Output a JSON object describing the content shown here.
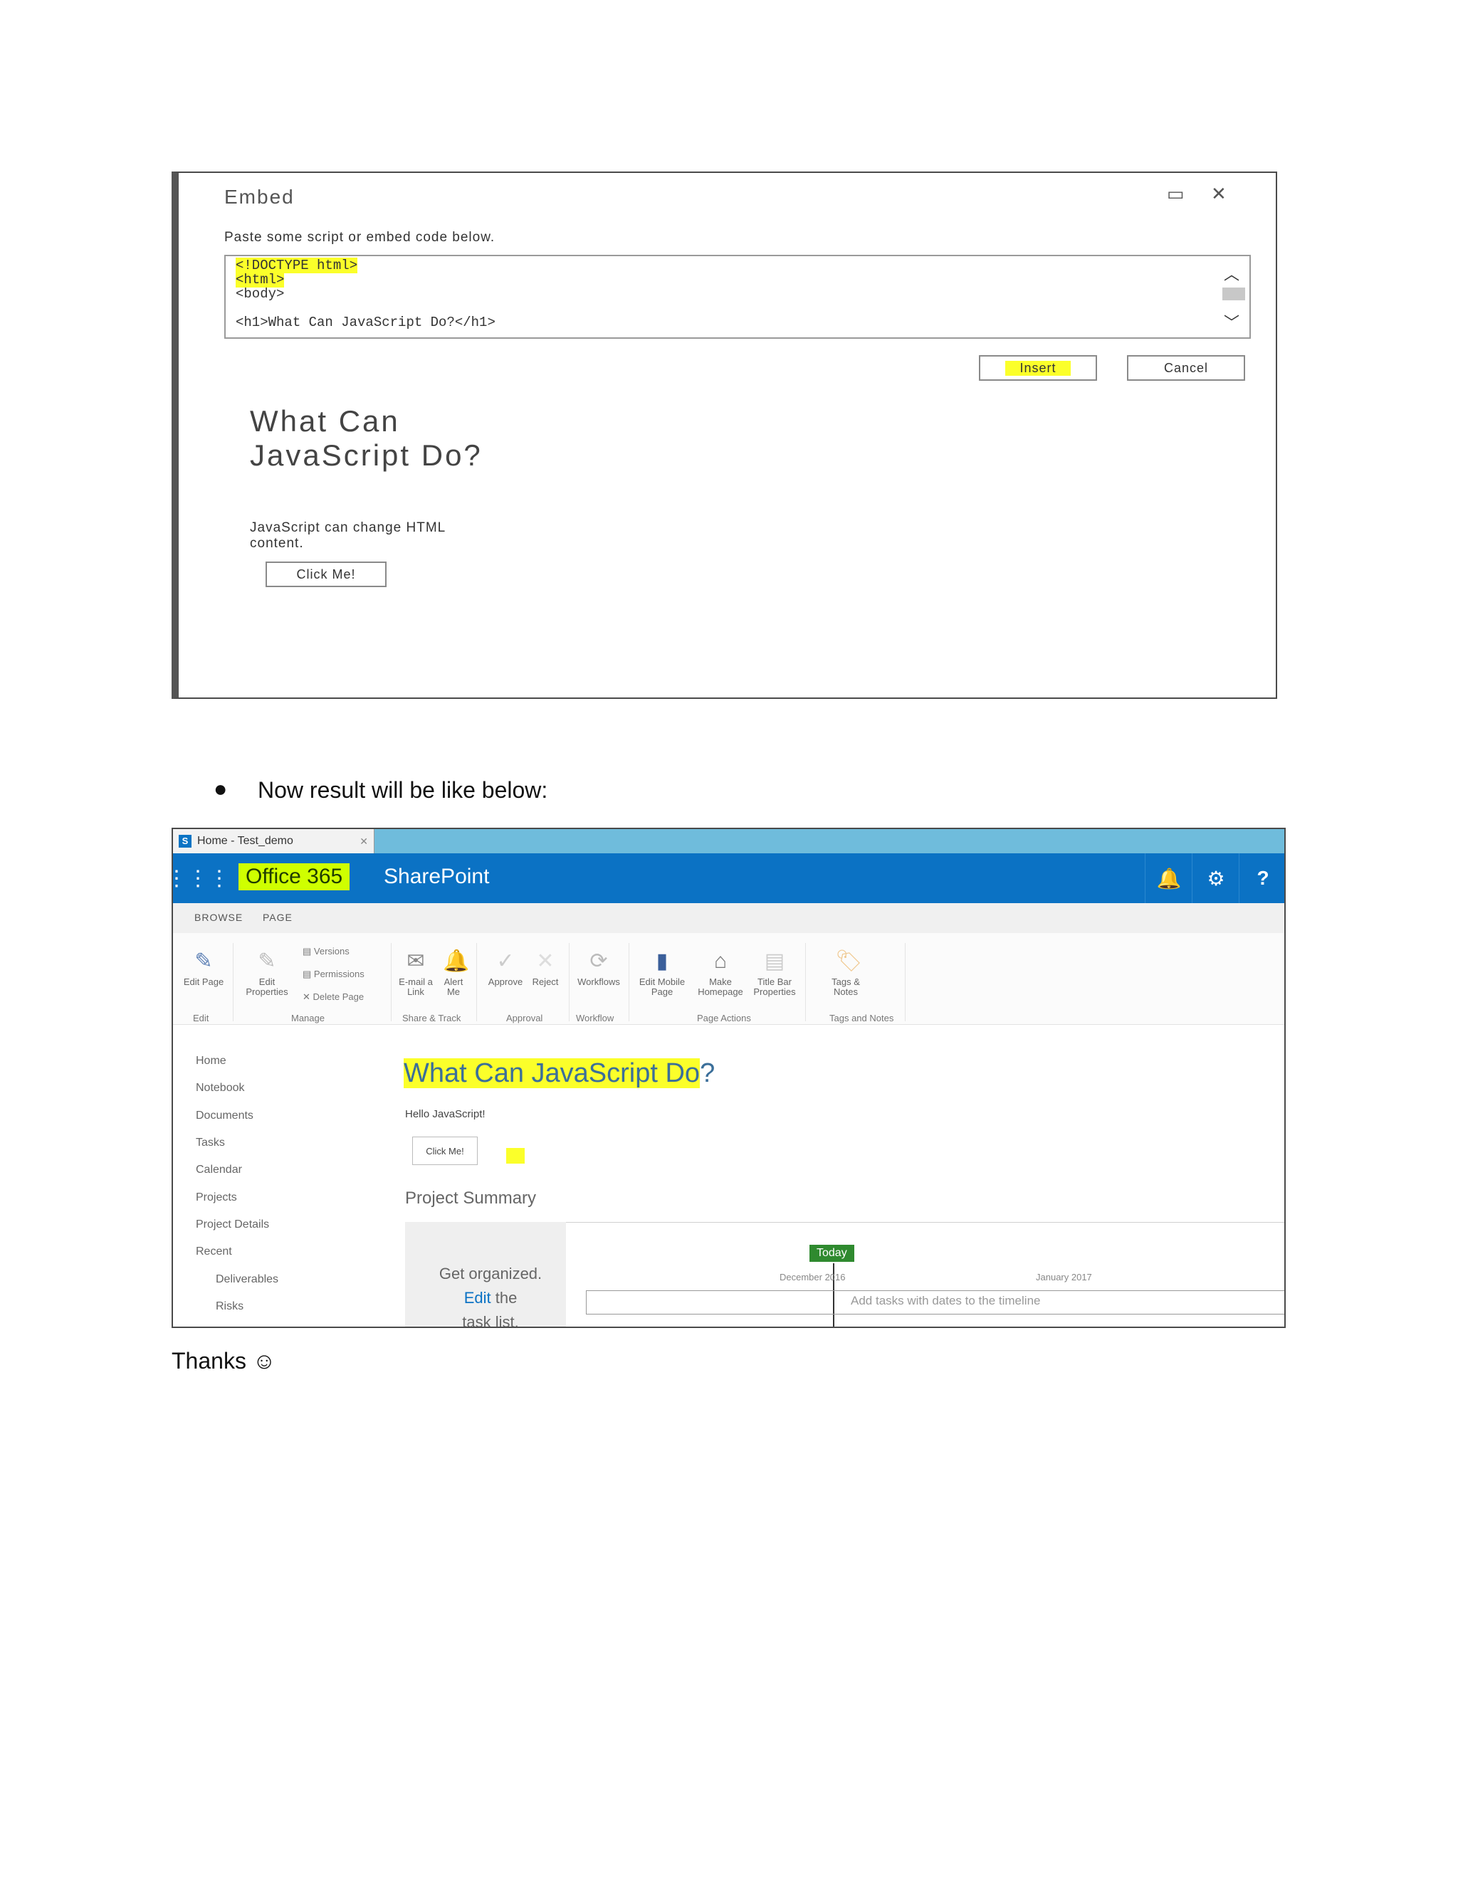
{
  "shot1": {
    "title": "Embed",
    "maximize_icon": "maximize-icon",
    "close_icon": "close-icon",
    "instruction": "Paste some script or embed code below.",
    "code_lines": [
      "<!DOCTYPE html>",
      "<html>",
      "<body>",
      "<h1>What Can JavaScript Do?</h1>"
    ],
    "insert_label": "Insert",
    "cancel_label": "Cancel",
    "preview_heading": "What Can JavaScript Do?",
    "preview_text": "JavaScript can change HTML content.",
    "preview_button": "Click Me!"
  },
  "bullet_text": "Now result will be like below:",
  "shot2": {
    "tab_title": "Home - Test_demo",
    "suite_app": "Office 365",
    "suite_site": "SharePoint",
    "ribbon_tabs": [
      "BROWSE",
      "PAGE"
    ],
    "ribbon_buttons": {
      "edit_page": "Edit Page",
      "edit_properties": "Edit Properties",
      "versions": "Versions",
      "permissions": "Permissions",
      "delete_page": "Delete Page",
      "email_link": "E-mail a Link",
      "alert_me": "Alert Me",
      "approve": "Approve",
      "reject": "Reject",
      "workflows": "Workflows",
      "edit_mobile": "Edit Mobile Page",
      "make_homepage": "Make Homepage",
      "title_bar": "Title Bar Properties",
      "tags_notes": "Tags & Notes"
    },
    "ribbon_groups": {
      "edit": "Edit",
      "manage": "Manage",
      "share_track": "Share & Track",
      "approval": "Approval",
      "workflow": "Workflow",
      "page_actions": "Page Actions",
      "tags_notes": "Tags and Notes"
    },
    "nav": [
      "Home",
      "Notebook",
      "Documents",
      "Tasks",
      "Calendar",
      "Projects",
      "Project Details",
      "Recent",
      "Deliverables",
      "Risks"
    ],
    "page_title_hl": "What Can JavaScript Do",
    "page_title_rest": "?",
    "hello": "Hello JavaScript!",
    "click_me": "Click Me!",
    "project_summary": "Project Summary",
    "get_organized": "Get organized.",
    "edit_link": "Edit",
    "edit_rest": " the",
    "task_list": "task list.",
    "today": "Today",
    "december": "December 2016",
    "january": "January 2017",
    "timeline_placeholder": "Add tasks with dates to the timeline"
  },
  "thanks": "Thanks ☺"
}
